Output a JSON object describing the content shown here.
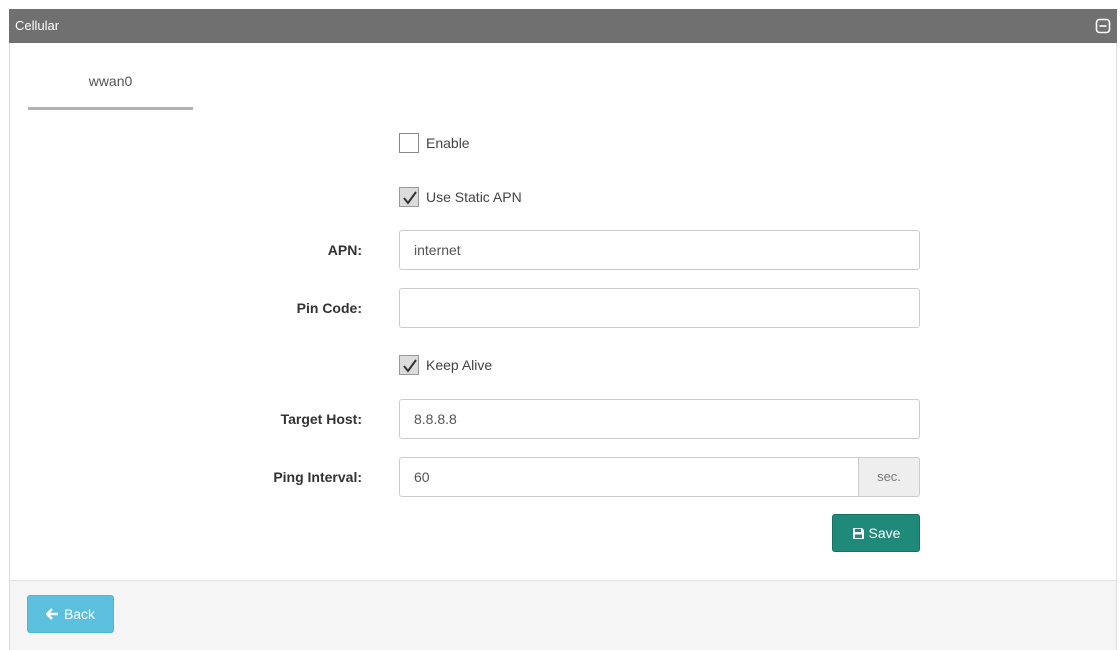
{
  "panel": {
    "title": "Cellular",
    "collapse_icon": "minus-square-icon"
  },
  "tabs": [
    {
      "label": "wwan0",
      "active": true
    }
  ],
  "form": {
    "enable": {
      "label": "Enable",
      "checked": false
    },
    "use_static_apn": {
      "label": "Use Static APN",
      "checked": true
    },
    "apn": {
      "label": "APN:",
      "value": "internet",
      "placeholder": ""
    },
    "pin_code": {
      "label": "Pin Code:",
      "value": "",
      "placeholder": ""
    },
    "keep_alive": {
      "label": "Keep Alive",
      "checked": true
    },
    "target_host": {
      "label": "Target Host:",
      "value": "8.8.8.8",
      "placeholder": ""
    },
    "ping_interval": {
      "label": "Ping Interval:",
      "value": "60",
      "unit": "sec."
    },
    "save_label": "Save",
    "save_icon": "floppy-disk-icon"
  },
  "footer": {
    "back_label": "Back",
    "back_icon": "arrow-left-icon"
  },
  "colors": {
    "header_bg": "#707070",
    "save_button": "#1f8a7a",
    "back_button": "#5bc0de",
    "footer_bg": "#f5f5f5"
  }
}
